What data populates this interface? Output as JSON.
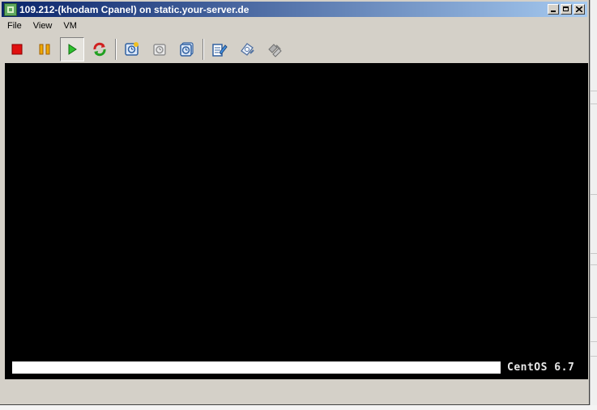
{
  "window": {
    "title": "109.212-(khodam Cpanel) on static.your-server.de"
  },
  "menu": {
    "items": [
      "File",
      "View",
      "VM"
    ]
  },
  "toolbar": {
    "buttons": [
      {
        "icon": "power-off-icon"
      },
      {
        "icon": "suspend-icon"
      },
      {
        "icon": "power-on-icon",
        "pressed": true
      },
      {
        "icon": "reset-icon"
      },
      {
        "icon": "take-snapshot-icon"
      },
      {
        "icon": "revert-snapshot-icon"
      },
      {
        "icon": "snapshot-manager-icon"
      },
      {
        "icon": "edit-settings-icon"
      },
      {
        "icon": "cd-dvd-icon"
      },
      {
        "icon": "floppy-icon"
      }
    ]
  },
  "console": {
    "os_label": "CentOS 6.7",
    "boot_progress_fraction": 0
  },
  "colors": {
    "titlebar_start": "#0a246a",
    "titlebar_end": "#a6caf0",
    "window_chrome": "#d4d0c8",
    "console_bg": "#000000"
  }
}
